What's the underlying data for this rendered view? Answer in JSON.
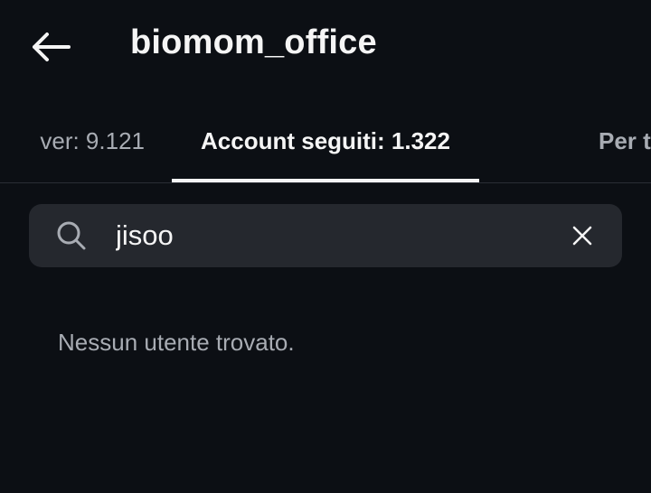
{
  "header": {
    "back_icon": "arrow-left-icon",
    "title": "biomom_office"
  },
  "tabs": [
    {
      "label": "ver: 9.121",
      "active": false
    },
    {
      "label": "Account seguiti: 1.322",
      "active": true
    },
    {
      "label": "Per t",
      "active": false
    }
  ],
  "search": {
    "icon": "search-icon",
    "value": "jisoo",
    "clear_icon": "close-icon"
  },
  "results": {
    "empty_message": "Nessun utente trovato."
  },
  "colors": {
    "background": "#0c0f14",
    "search_bg": "#25282e",
    "text_primary": "#f5f5f5",
    "text_secondary": "#a8acb3"
  }
}
